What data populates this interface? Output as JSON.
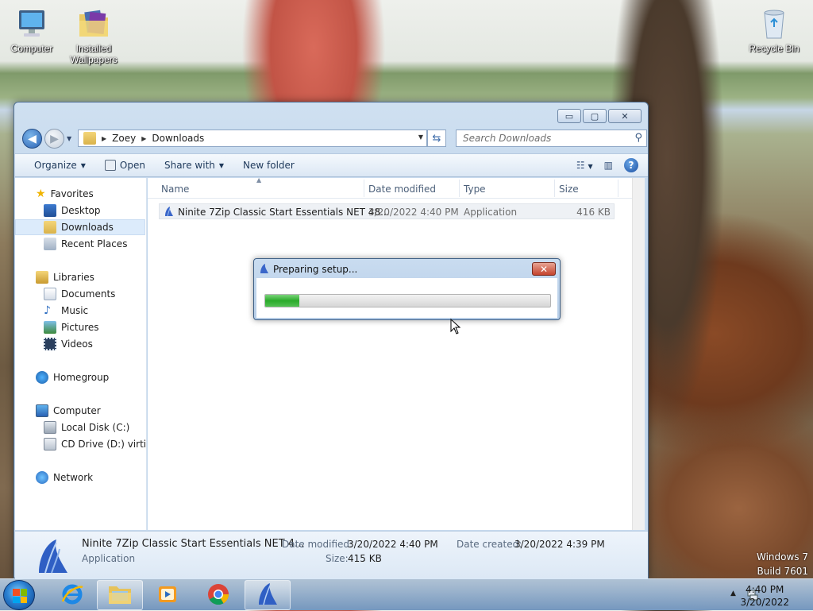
{
  "desktop": {
    "icons": [
      {
        "label": "Computer"
      },
      {
        "label": "Installed Wallpapers"
      },
      {
        "label": "Recycle Bin"
      }
    ],
    "watermark": {
      "line1": "Windows 7",
      "line2": "Build 7601"
    }
  },
  "window": {
    "title_buttons": {
      "minimize": "▭",
      "maximize": "▢",
      "close": "✕"
    },
    "address": {
      "crumbs": [
        "Zoey",
        "Downloads"
      ]
    },
    "search": {
      "placeholder": "Search Downloads"
    },
    "toolbar": {
      "organize": "Organize",
      "open": "Open",
      "share_with": "Share with",
      "new_folder": "New folder",
      "help": "?"
    },
    "nav": {
      "favorites": "Favorites",
      "desktop": "Desktop",
      "downloads": "Downloads",
      "recent_places": "Recent Places",
      "libraries": "Libraries",
      "documents": "Documents",
      "music": "Music",
      "pictures": "Pictures",
      "videos": "Videos",
      "homegroup": "Homegroup",
      "computer": "Computer",
      "local_disk": "Local Disk (C:)",
      "cd_drive": "CD Drive (D:) virtio-w",
      "network": "Network"
    },
    "columns": {
      "name": "Name",
      "date_modified": "Date modified",
      "type": "Type",
      "size": "Size"
    },
    "files": [
      {
        "name": "Ninite 7Zip Classic Start Essentials NET 48...",
        "date_modified": "3/20/2022 4:40 PM",
        "type": "Application",
        "size": "416 KB"
      }
    ],
    "details": {
      "name": "Ninite 7Zip Classic Start Essentials NET 4...",
      "type": "Application",
      "date_modified_label": "Date modified:",
      "date_modified": "3/20/2022 4:40 PM",
      "size_label": "Size:",
      "size": "415 KB",
      "date_created_label": "Date created:",
      "date_created": "3/20/2022 4:39 PM"
    }
  },
  "dialog": {
    "title": "Preparing setup...",
    "close": "✕",
    "progress_fraction": 0.12
  },
  "taskbar": {
    "clock_time": "4:40 PM",
    "clock_date": "3/20/2022",
    "tray_chevron": "▲",
    "pinned": [
      "internet-explorer-icon",
      "windows-explorer-icon",
      "media-player-icon",
      "chrome-icon",
      "ninite-icon"
    ]
  },
  "colors": {
    "accent": "#2a62b4",
    "progress": "#2aaa2a",
    "selection": "#dcebfb"
  }
}
